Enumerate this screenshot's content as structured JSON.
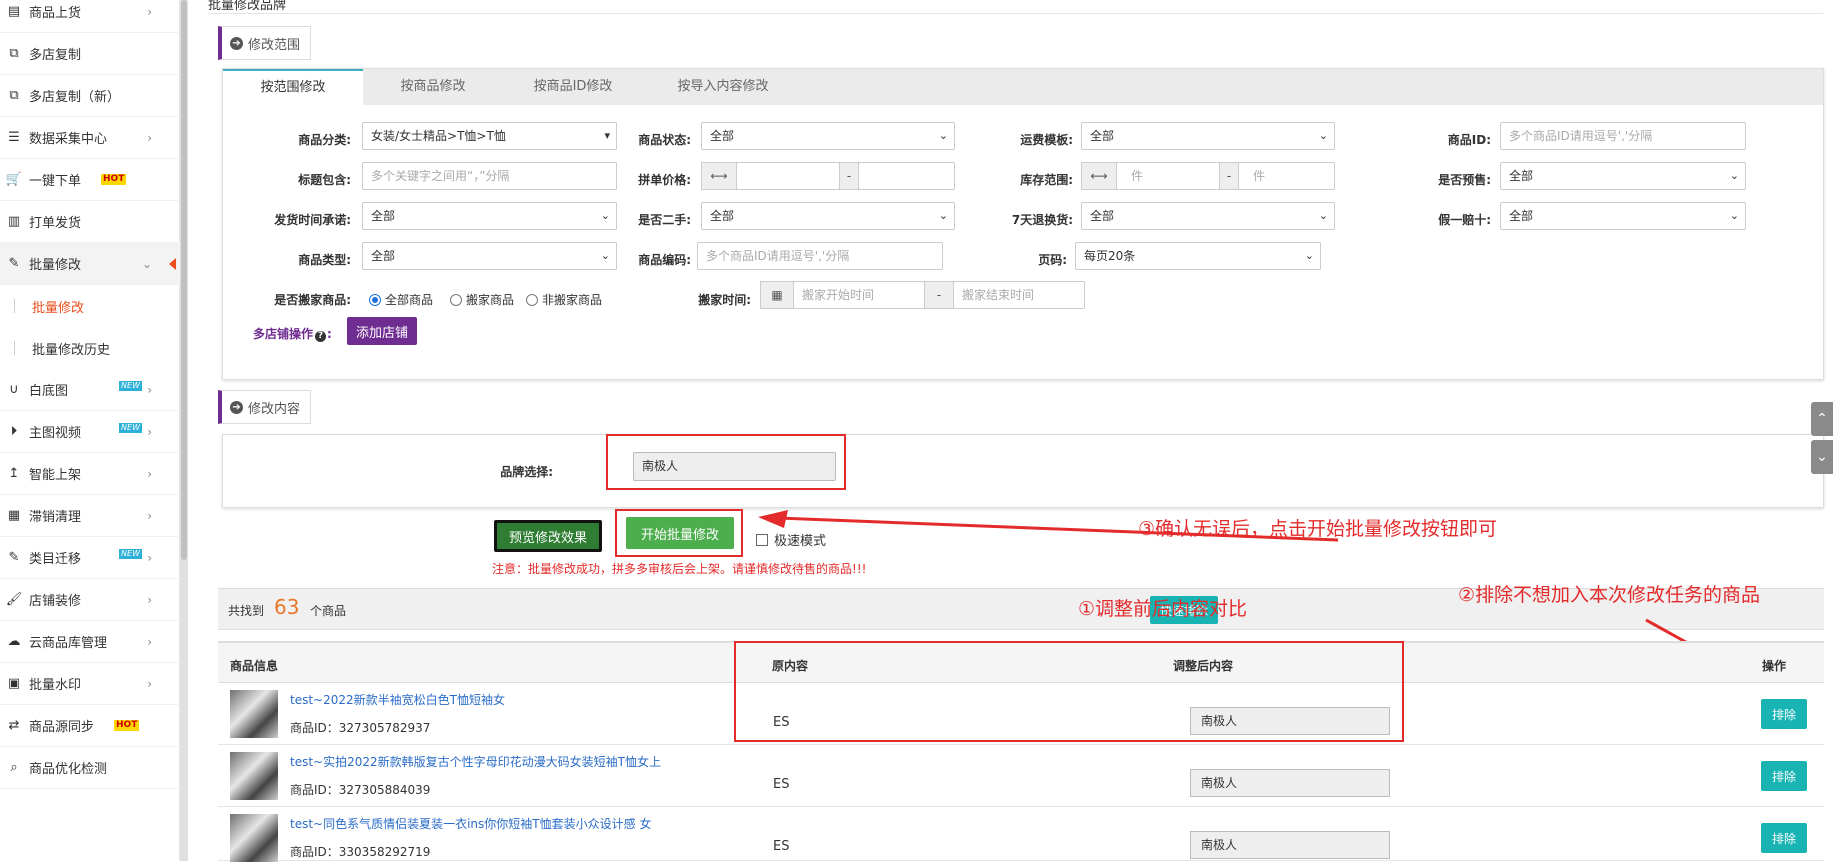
{
  "sidebar": {
    "items": [
      {
        "label": "商品上货",
        "icon": "clipboard-icon",
        "arrow": "›"
      },
      {
        "label": "多店复制",
        "icon": "copy-icon",
        "arrow": ""
      },
      {
        "label": "多店复制（新）",
        "icon": "copy-icon",
        "arrow": ""
      },
      {
        "label": "数据采集中心",
        "icon": "database-icon",
        "arrow": "›"
      },
      {
        "label": "一键下单",
        "icon": "cart-icon",
        "badge": "HOT",
        "arrow": ""
      },
      {
        "label": "打单发货",
        "icon": "barcode-icon",
        "arrow": ""
      },
      {
        "label": "批量修改",
        "icon": "edit-icon",
        "arrow": "⌄"
      },
      {
        "label": "白底图",
        "icon": "magnet-icon",
        "badge": "NEW",
        "arrow": "›"
      },
      {
        "label": "主图视频",
        "icon": "play-icon",
        "badge": "NEW",
        "arrow": "›"
      },
      {
        "label": "智能上架",
        "icon": "upload-icon",
        "arrow": "›"
      },
      {
        "label": "滞销清理",
        "icon": "calculator-icon",
        "arrow": "›"
      },
      {
        "label": "类目迁移",
        "icon": "edit-icon",
        "badge": "NEW",
        "arrow": "›"
      },
      {
        "label": "店铺装修",
        "icon": "brush-icon",
        "arrow": "›"
      },
      {
        "label": "云商品库管理",
        "icon": "cloud-icon",
        "arrow": "›"
      },
      {
        "label": "批量水印",
        "icon": "image-icon",
        "arrow": "›"
      },
      {
        "label": "商品源同步",
        "icon": "sync-icon",
        "badge": "HOT",
        "arrow": ""
      },
      {
        "label": "商品优化检测",
        "icon": "search-icon",
        "arrow": ""
      }
    ],
    "sub": [
      {
        "label": "批量修改"
      },
      {
        "label": "批量修改历史"
      }
    ]
  },
  "page": {
    "title": "批量修改品牌"
  },
  "scope": {
    "tag": "修改范围",
    "tabs": [
      "按范围修改",
      "按商品修改",
      "按商品ID修改",
      "按导入内容修改"
    ],
    "fields": {
      "category_label": "商品分类:",
      "category_value": "女装/女士精品>T恤>T恤",
      "status_label": "商品状态:",
      "status_value": "全部",
      "freight_label": "运费模板:",
      "freight_value": "全部",
      "goodsid_label": "商品ID:",
      "goodsid_ph": "多个商品ID请用逗号','分隔",
      "title_label": "标题包含:",
      "title_ph": "多个关键字之间用“，”分隔",
      "price_label": "拼单价格:",
      "stock_label": "库存范围:",
      "stock_unit": "件",
      "presale_label": "是否预售:",
      "presale_value": "全部",
      "ship_label": "发货时间承诺:",
      "ship_value": "全部",
      "second_label": "是否二手:",
      "second_value": "全部",
      "return_label": "7天退换货:",
      "return_value": "全部",
      "fake_label": "假一赔十:",
      "fake_value": "全部",
      "type_label": "商品类型:",
      "type_value": "全部",
      "code_label": "商品编码:",
      "code_ph": "多个商品ID请用逗号','分隔",
      "page_label": "页码:",
      "page_value": "每页20条",
      "moved_label": "是否搬家商品:",
      "moved_opts": [
        "全部商品",
        "搬家商品",
        "非搬家商品"
      ],
      "movetime_label": "搬家时间:",
      "movetime_start_ph": "搬家开始时间",
      "movetime_end_ph": "搬家结束时间",
      "multistore_label": "多店铺操作",
      "add_store": "添加店铺",
      "dash": "-",
      "range_icon": "⟷"
    }
  },
  "content": {
    "tag": "修改内容",
    "brand_label": "品牌选择:",
    "brand_value": "南极人"
  },
  "actions": {
    "preview": "预览修改效果",
    "start": "开始批量修改",
    "fast_mode": "极速模式",
    "warning": "注意：批量修改成功，拼多多审核后会上架。请谨慎修改待售的商品!!!"
  },
  "annotations": {
    "a1": "①调整前后内容对比",
    "a2": "②排除不想加入本次修改任务的商品",
    "a3": "③确认无误后，点击开始批量修改按钮即可"
  },
  "results": {
    "found_prefix": "共找到",
    "count": "63",
    "found_suffix": "个商品",
    "quick_exclude": "快速排除",
    "headers": {
      "info": "商品信息",
      "orig": "原内容",
      "after": "调整后内容",
      "op": "操作"
    },
    "id_prefix": "商品ID：",
    "rows": [
      {
        "title": "test~2022新款半袖宽松白色T恤短袖女",
        "id": "327305782937",
        "orig": "ES",
        "after": "南极人",
        "btn": "排除"
      },
      {
        "title": "test~实拍2022新款韩版复古个性字母印花动漫大码女装短袖T恤女上",
        "id": "327305884039",
        "orig": "ES",
        "after": "南极人",
        "btn": "排除"
      },
      {
        "title": "test~同色系气质情侣装夏装一衣ins你你短袖T恤套装小众设计感 女",
        "id": "330358292719",
        "orig": "ES",
        "after": "南极人",
        "btn": "排除"
      }
    ]
  },
  "colors": {
    "accent": "#6f2c91",
    "green": "#4cae4c",
    "teal": "#18b3b3",
    "red": "#e42b2b"
  }
}
